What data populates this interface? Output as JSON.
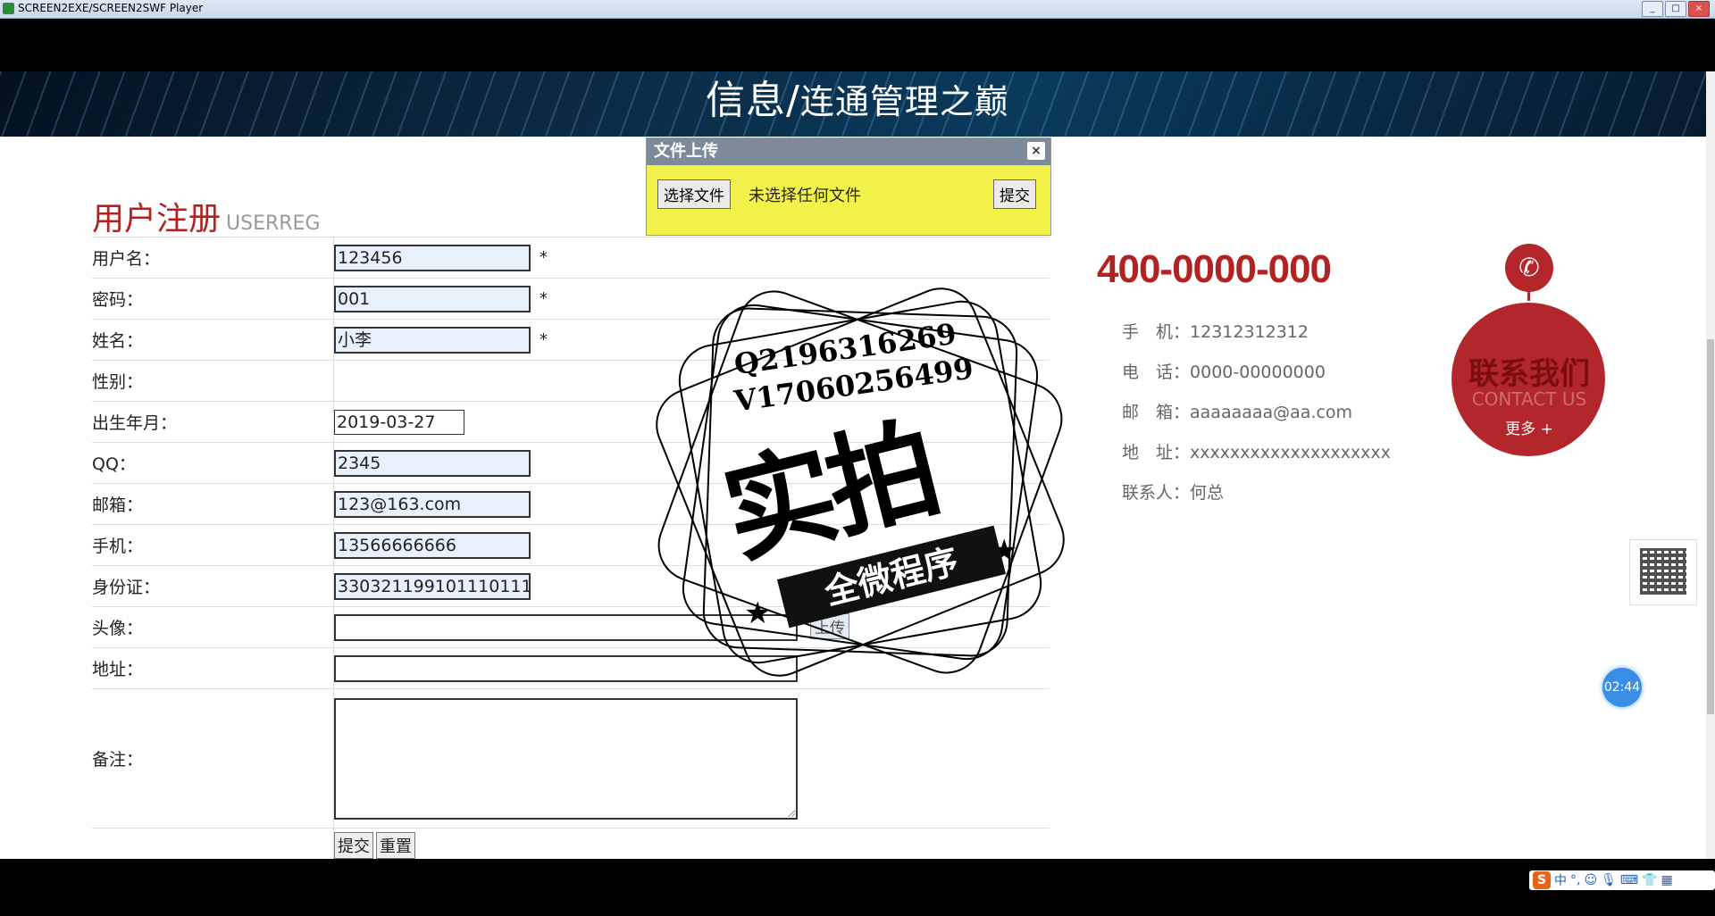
{
  "window": {
    "title": "SCREEN2EXE/SCREEN2SWF Player",
    "controls": [
      "_",
      "□",
      "×"
    ]
  },
  "banner": {
    "slogan_main": "信息",
    "slogan_sep": "/",
    "slogan_rest": "连通管理之巅"
  },
  "registration": {
    "title": "用户注册",
    "title_en": "USERREG",
    "required_mark": "*",
    "fields": {
      "username": {
        "label": "用户名：",
        "value": "123456"
      },
      "password": {
        "label": "密码：",
        "value": "001"
      },
      "name": {
        "label": "姓名：",
        "value": "小李"
      },
      "gender": {
        "label": "性别：",
        "value": ""
      },
      "birth": {
        "label": "出生年月：",
        "value": "2019-03-27"
      },
      "qq": {
        "label": "QQ：",
        "value": "2345"
      },
      "email": {
        "label": "邮箱：",
        "value": "123@163.com"
      },
      "phone": {
        "label": "手机：",
        "value": "13566666666"
      },
      "idcard": {
        "label": "身份证：",
        "value": "330321199101110111"
      },
      "avatar": {
        "label": "头像：",
        "value": "",
        "upload_label": "上传"
      },
      "address": {
        "label": "地址：",
        "value": ""
      },
      "remark": {
        "label": "备注：",
        "value": ""
      }
    },
    "submit_label": "提交",
    "reset_label": "重置"
  },
  "upload_dialog": {
    "title": "文件上传",
    "close": "×",
    "choose_label": "选择文件",
    "no_file": "未选择任何文件",
    "submit_label": "提交"
  },
  "contact": {
    "hotline": "400-0000-000",
    "items": [
      {
        "label": "手　机：",
        "value": "12312312312"
      },
      {
        "label": "电　话：",
        "value": "0000-00000000"
      },
      {
        "label": "邮　箱：",
        "value": "aaaaaaaa@aa.com"
      },
      {
        "label": "地　址：",
        "value": "xxxxxxxxxxxxxxxxxxxx"
      },
      {
        "label": "联系人：",
        "value": "何总"
      }
    ],
    "badge_title": "联系我们",
    "badge_en": "CONTACT US",
    "badge_more": "更多 +"
  },
  "timer": "02:44",
  "watermark": {
    "line1": "Q2196316269",
    "line2": "V17060256499",
    "big": "实拍",
    "ribbon": "全微程序"
  },
  "tray": {
    "ime": "中",
    "punct": "°,"
  },
  "icons": {
    "phone": "phone-icon",
    "qr": "qr-code-icon",
    "sogou": "sogou-ime-icon"
  }
}
